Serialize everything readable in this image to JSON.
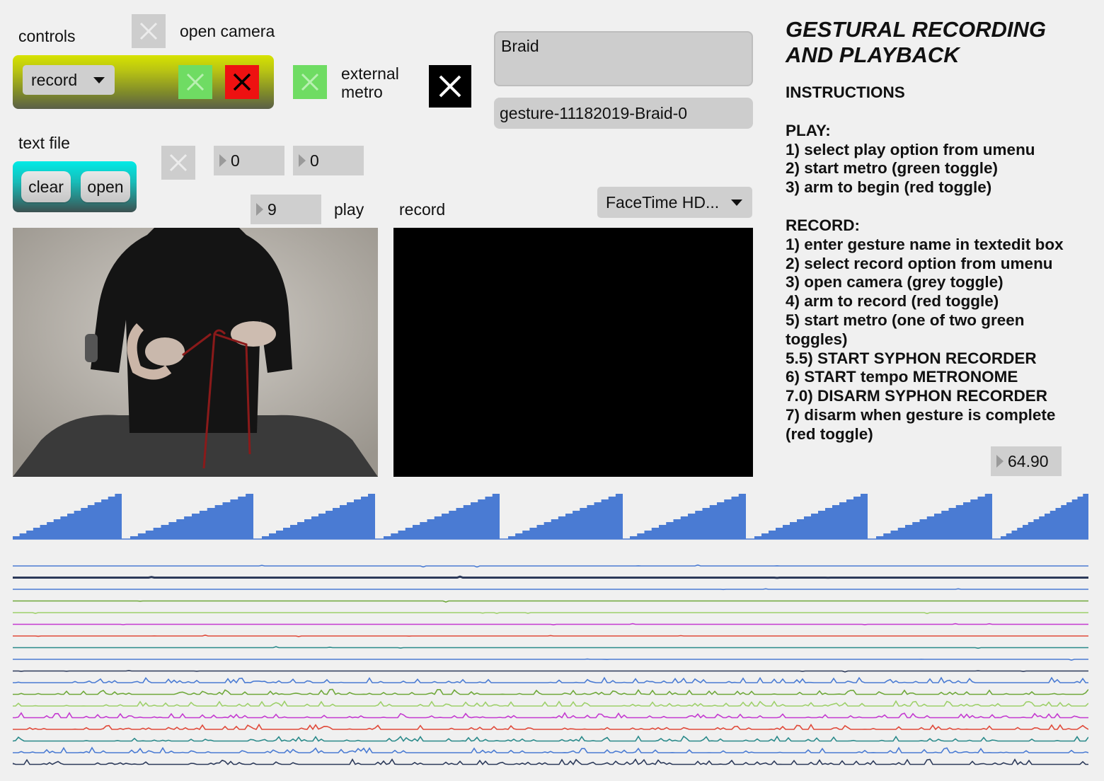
{
  "controls": {
    "label": "controls",
    "umenu_value": "record",
    "open_camera_label": "open camera",
    "external_metro_line1": "external",
    "external_metro_line2": "metro"
  },
  "text_file": {
    "label": "text file",
    "clear_label": "clear",
    "open_label": "open"
  },
  "numbers": {
    "box1": "0",
    "box2": "0",
    "play_index": "9",
    "tempo": "64.90"
  },
  "labels": {
    "play": "play",
    "record": "record"
  },
  "gesture": {
    "name_value": "Braid",
    "filename": "gesture-11182019-Braid-0"
  },
  "camera_menu": "FaceTime HD...",
  "title_line1": "GESTURAL RECORDING",
  "title_line2": "AND PLAYBACK",
  "instructions": {
    "heading": "INSTRUCTIONS",
    "play_heading": "PLAY:",
    "play_steps": [
      "1) select play option from umenu",
      "2) start metro (green toggle)",
      "3) arm to begin (red toggle)"
    ],
    "record_heading": "RECORD:",
    "record_steps": [
      "1) enter gesture name in textedit box",
      "2) select record option from umenu",
      "3) open camera (grey toggle)",
      "4) arm to record (red toggle)",
      "5) start metro (one of two green",
      "toggles)",
      "5.5) START SYPHON RECORDER",
      "6) START tempo METRONOME",
      "7.0) DISARM SYPHON RECORDER",
      "7) disarm when gesture is complete",
      "(red toggle)"
    ]
  },
  "colors": {
    "ramp": "#4a7bd3",
    "traces": [
      "#4a7bd3",
      "#2c3a5a",
      "#4a7bd3",
      "#6fa83a",
      "#9ed06a",
      "#c43ad0",
      "#e04a3a",
      "#2a8a8a",
      "#4a7bd3",
      "#2c3a5a",
      "#4a7bd3",
      "#6fa83a",
      "#9ed06a",
      "#c43ad0",
      "#e04a3a",
      "#2a8a8a",
      "#4a7bd3",
      "#2c3a5a"
    ]
  }
}
